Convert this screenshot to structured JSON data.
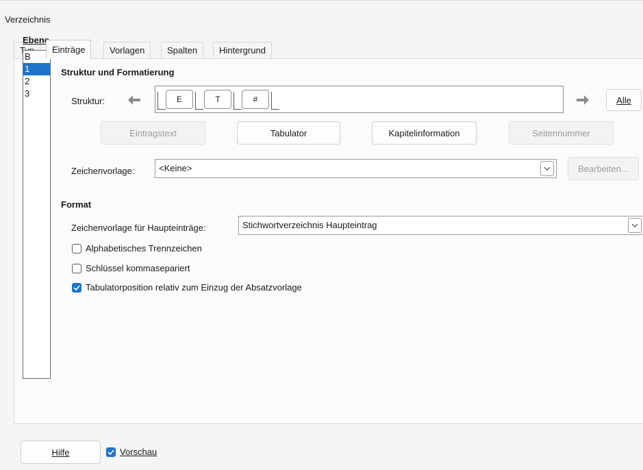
{
  "window": {
    "title": "Verzeichnis"
  },
  "tabs": [
    {
      "label": "Typ"
    },
    {
      "label": "Einträge",
      "active": true
    },
    {
      "label": "Vorlagen"
    },
    {
      "label": "Spalten"
    },
    {
      "label": "Hintergrund"
    }
  ],
  "levels": {
    "header": "Ebene",
    "items": [
      "B",
      "1",
      "2",
      "3"
    ],
    "selected": "1"
  },
  "structure_section": {
    "heading": "Struktur und Formatierung",
    "structure_label": "Struktur:",
    "tokens": [
      "E",
      "T",
      "#"
    ],
    "all_button": "Alle",
    "buttons": {
      "entry_text": "Eintragstext",
      "tab": "Tabulator",
      "chapter_info": "Kapitelinformation",
      "page_number": "Seitennummer"
    },
    "char_style_label": "Zeichenvorlage:",
    "char_style_value": "<Keine>",
    "edit_button": "Bearbeiten..."
  },
  "format_section": {
    "heading": "Format",
    "main_entry_style_label": "Zeichenvorlage für Haupteinträge:",
    "main_entry_style_value": "Stichwortverzeichnis Haupteintrag",
    "checkboxes": [
      {
        "label": "Alphabetisches Trennzeichen",
        "checked": false
      },
      {
        "label": "Schlüssel kommasepariert",
        "checked": false
      },
      {
        "label": "Tabulatorposition relativ zum Einzug der Absatzvorlage",
        "checked": true
      }
    ]
  },
  "footer": {
    "help_button": "Hilfe",
    "preview_label": "Vorschau",
    "preview_checked": true
  },
  "colors": {
    "accent": "#1d73c9",
    "disabled_text": "#9a9a9a"
  }
}
